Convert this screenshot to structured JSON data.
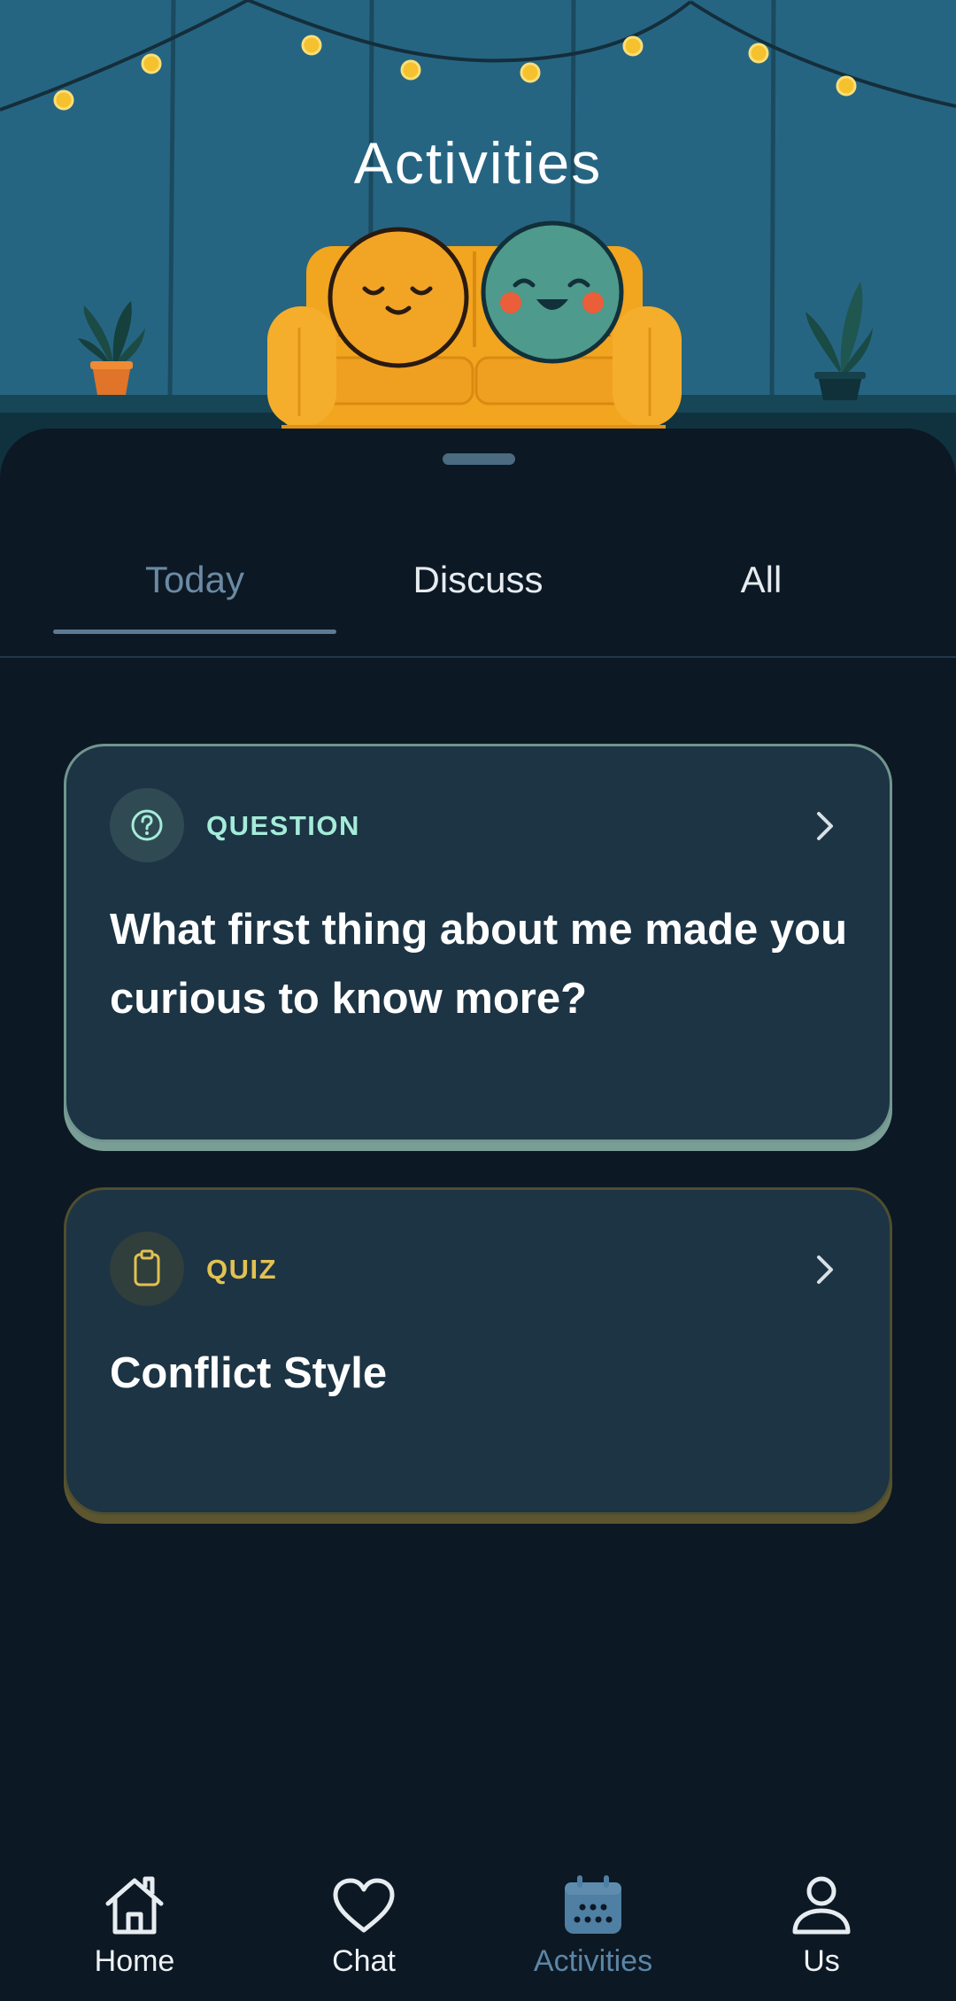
{
  "header": {
    "title": "Activities"
  },
  "tabs": [
    {
      "label": "Today",
      "active": true
    },
    {
      "label": "Discuss",
      "active": false
    },
    {
      "label": "All",
      "active": false
    }
  ],
  "cards": [
    {
      "tag": "QUESTION",
      "title": "What first thing about me made you curious to know more?",
      "icon": "question-circle-icon",
      "accent": "#a4ecd9"
    },
    {
      "tag": "QUIZ",
      "title": "Conflict Style",
      "icon": "clipboard-icon",
      "accent": "#e2c152"
    }
  ],
  "nav": [
    {
      "label": "Home",
      "icon": "home-icon",
      "active": false
    },
    {
      "label": "Chat",
      "icon": "heart-icon",
      "active": false
    },
    {
      "label": "Activities",
      "icon": "calendar-icon",
      "active": true
    },
    {
      "label": "Us",
      "icon": "person-icon",
      "active": false
    }
  ],
  "colors": {
    "background": "#0c1824",
    "card": "#1c3444",
    "active_tab": "#6b8aa3",
    "active_nav": "#5b86a6"
  }
}
